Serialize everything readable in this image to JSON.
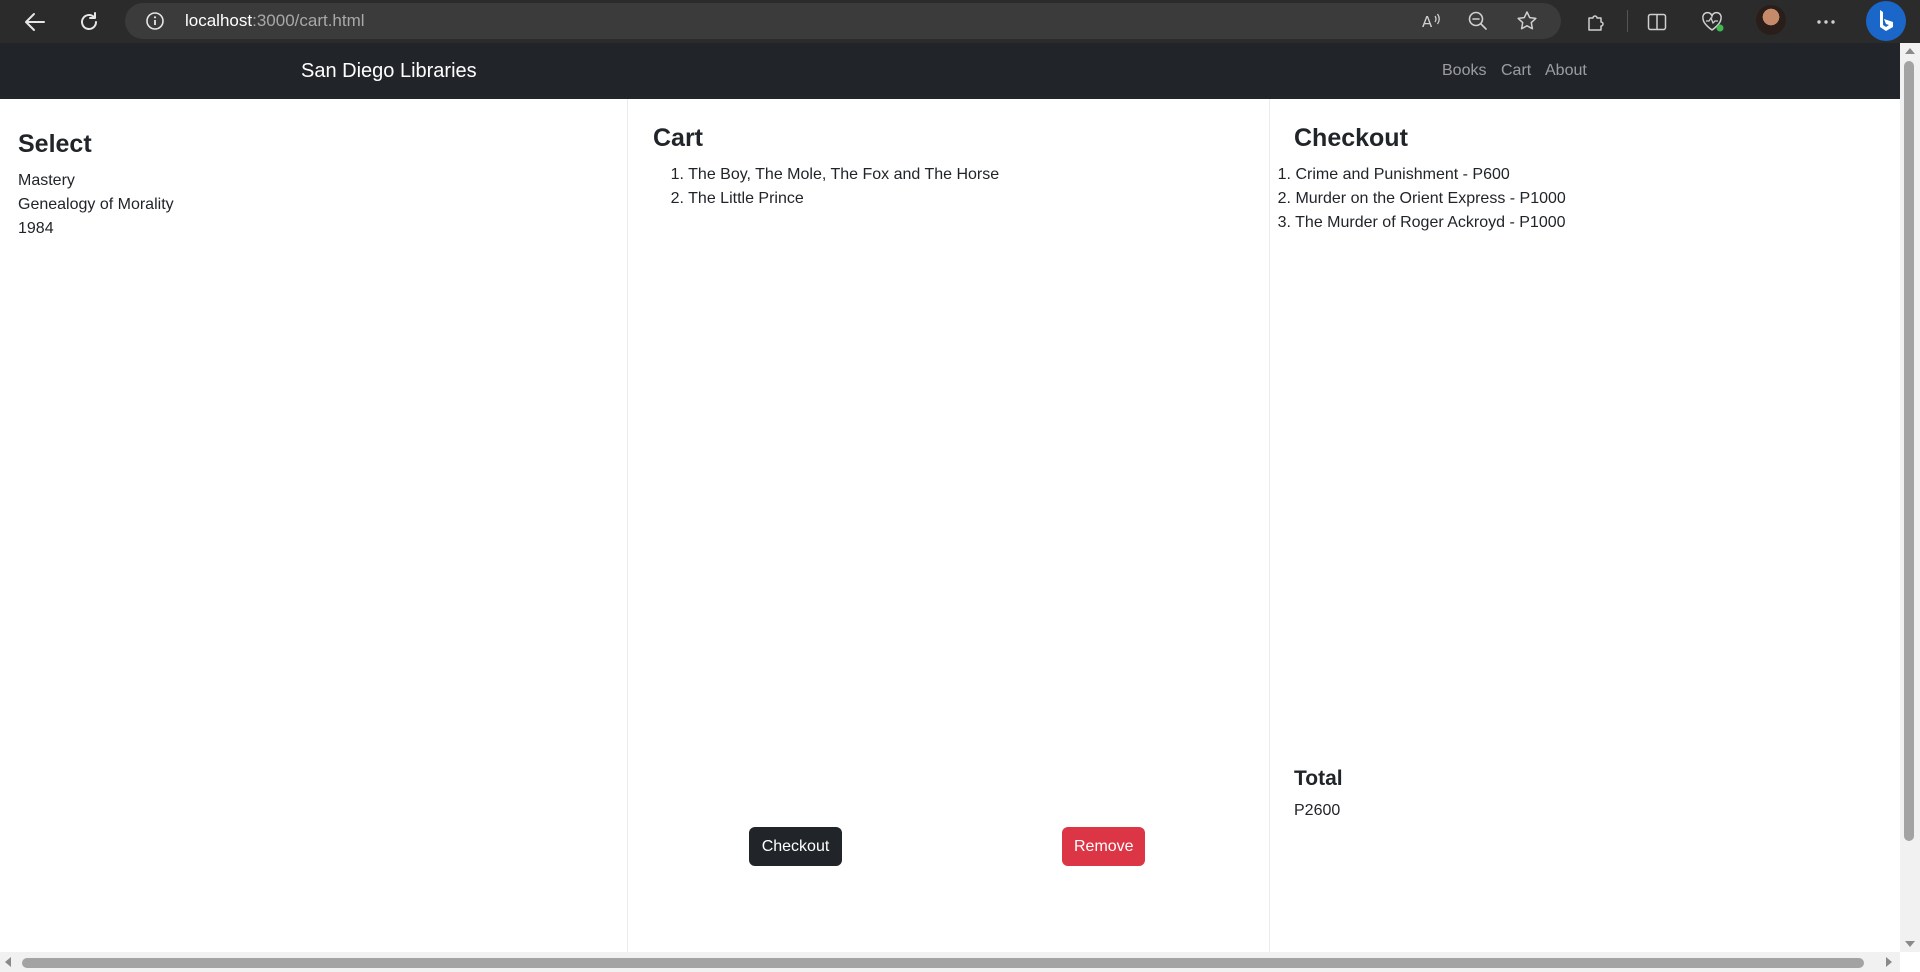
{
  "browser": {
    "url_host": "localhost",
    "url_path": ":3000/cart.html"
  },
  "navbar": {
    "brand": "San Diego Libraries",
    "links": [
      "Books",
      "Cart",
      "About"
    ]
  },
  "select": {
    "title": "Select",
    "items": [
      "Mastery",
      "Genealogy of Morality",
      "1984"
    ]
  },
  "cart": {
    "title": "Cart",
    "items": [
      {
        "num": "1.",
        "text": "The Boy, The Mole, The Fox and The Horse"
      },
      {
        "num": "2.",
        "text": "The Little Prince"
      }
    ],
    "checkout_label": "Checkout",
    "remove_label": "Remove"
  },
  "checkout": {
    "title": "Checkout",
    "items": [
      {
        "num": "1.",
        "text": "Crime and Punishment - P600"
      },
      {
        "num": "2.",
        "text": "Murder on the Orient Express - P1000"
      },
      {
        "num": "3.",
        "text": "The Murder of Roger Ackroyd - P1000"
      }
    ],
    "total_label": "Total",
    "total_value": "P2600"
  },
  "colors": {
    "navbar_bg": "#212529",
    "checkout_button": "#212529",
    "remove_button": "#dc3545"
  }
}
